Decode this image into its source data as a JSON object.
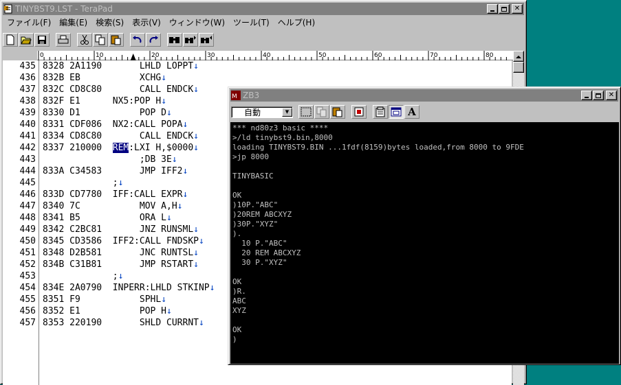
{
  "editor_window": {
    "title": "TINYBST9.LST - TeraPad",
    "menu": [
      "ファイル(F)",
      "編集(E)",
      "検索(S)",
      "表示(V)",
      "ウィンドウ(W)",
      "ツール(T)",
      "ヘルプ(H)"
    ],
    "toolbar_icons": [
      "new-file-icon",
      "open-folder-icon",
      "save-icon",
      "print-icon",
      "cut-icon",
      "copy-icon",
      "paste-icon",
      "undo-icon",
      "redo-icon",
      "find-icon",
      "find-next-icon",
      "find-prev-icon"
    ],
    "ruler_labels": [
      "0",
      "10",
      "20",
      "30",
      "40",
      "50",
      "60",
      "70",
      "80"
    ],
    "lines": [
      {
        "n": "435",
        "text": "8328 2A1190       LHLD LOPPT",
        "nl": true
      },
      {
        "n": "436",
        "text": "832B EB           XCHG",
        "nl": true
      },
      {
        "n": "437",
        "text": "832C CD8C80       CALL ENDCK",
        "nl": true
      },
      {
        "n": "438",
        "text": "832F E1      NX5:POP H",
        "nl": true
      },
      {
        "n": "439",
        "text": "8330 D1           POP D",
        "nl": true
      },
      {
        "n": "440",
        "text": "8331 CDF086  NX2:CALL POPA",
        "nl": true
      },
      {
        "n": "441",
        "text": "8334 CD8C80       CALL ENDCK",
        "nl": true
      },
      {
        "n": "442",
        "pre": "8337 210000  ",
        "sel": "REM",
        "text": ":LXI H,$0000",
        "nl": true
      },
      {
        "n": "443",
        "text": "                  ;DB 3E",
        "nl": true
      },
      {
        "n": "444",
        "text": "833A C34583       JMP IFF2",
        "nl": true
      },
      {
        "n": "445",
        "text": "             ;",
        "nl": true
      },
      {
        "n": "446",
        "text": "833D CD7780  IFF:CALL EXPR",
        "nl": true
      },
      {
        "n": "447",
        "text": "8340 7C           MOV A,H",
        "nl": true
      },
      {
        "n": "448",
        "text": "8341 B5           ORA L",
        "nl": true
      },
      {
        "n": "449",
        "text": "8342 C2BC81       JNZ RUNSML",
        "nl": true
      },
      {
        "n": "450",
        "text": "8345 CD3586  IFF2:CALL FNDSKP",
        "nl": true
      },
      {
        "n": "451",
        "text": "8348 D2B581       JNC RUNTSL",
        "nl": true
      },
      {
        "n": "452",
        "text": "834B C31B81       JMP RSTART",
        "nl": true
      },
      {
        "n": "453",
        "text": "             ;",
        "nl": true
      },
      {
        "n": "454",
        "text": "834E 2A0790  INPERR:LHLD STKINP",
        "nl": true
      },
      {
        "n": "455",
        "text": "8351 F9           SPHL",
        "nl": true
      },
      {
        "n": "456",
        "text": "8352 E1           POP H",
        "nl": true
      },
      {
        "n": "457",
        "text": "8353 220190       SHLD CURRNT",
        "nl": true
      }
    ],
    "newline_mark": "↓"
  },
  "terminal_window": {
    "title": "ZB3",
    "mode_select": "自動",
    "toolbar_icons": [
      "select-icon",
      "copy-icon",
      "paste-icon",
      "settings-icon",
      "properties-icon",
      "window-icon",
      "font-icon"
    ],
    "font_button_label": "A",
    "lines": [
      "*** nd80z3 basic ****",
      ">/ld tinybst9.bin,8000",
      "loading TINYBST9.BIN ...1fdf(8159)bytes loaded,from 8000 to 9FDE",
      ">jp 8000",
      "",
      "TINYBASIC",
      "",
      "OK",
      ")10P.\"ABC\"",
      ")20REM ABCXYZ",
      ")30P.\"XYZ\"",
      ").",
      "  10 P.\"ABC\"",
      "  20 REM ABCXYZ",
      "  30 P.\"XYZ\"",
      "",
      "OK",
      ")R.",
      "ABC",
      "XYZ",
      "",
      "OK",
      ")"
    ]
  },
  "colors": {
    "desktop": "#008080",
    "selection": "#000080",
    "newline_mark": "#0040c0"
  }
}
